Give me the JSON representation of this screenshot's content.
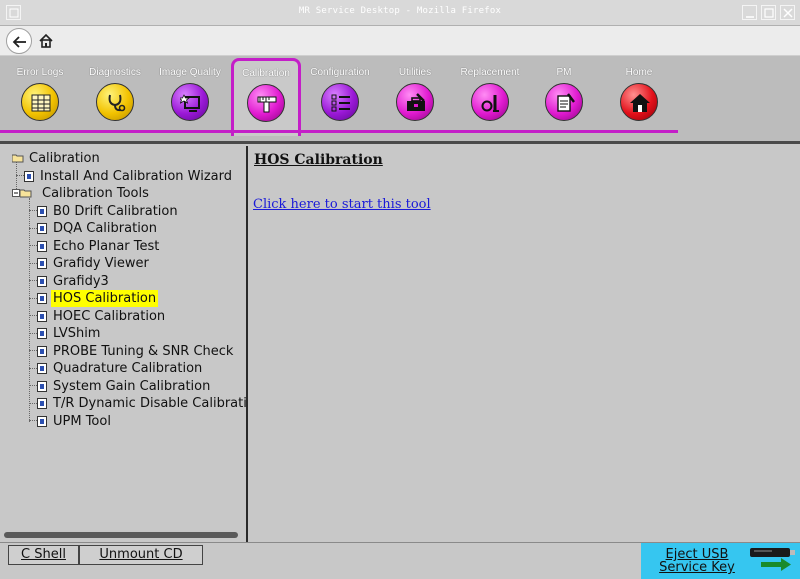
{
  "window": {
    "title": "MR Service Desktop - Mozilla Firefox"
  },
  "toolbar": {
    "tabs": [
      {
        "label": "Error Logs",
        "icon": "error-logs-icon",
        "color": "#f2c200"
      },
      {
        "label": "Diagnostics",
        "icon": "stethoscope-icon",
        "color": "#f2c200"
      },
      {
        "label": "Image Quality",
        "icon": "image-quality-icon",
        "color": "#9a18d6"
      },
      {
        "label": "Calibration",
        "icon": "caliper-icon",
        "color": "#e01ad0",
        "active": true
      },
      {
        "label": "Configuration",
        "icon": "checklist-icon",
        "color": "#9a18d6"
      },
      {
        "label": "Utilities",
        "icon": "toolbox-icon",
        "color": "#e01ad0"
      },
      {
        "label": "Replacement",
        "icon": "replacement-icon",
        "color": "#e01ad0"
      },
      {
        "label": "PM",
        "icon": "pm-icon",
        "color": "#e01ad0"
      },
      {
        "label": "Home",
        "icon": "home-icon",
        "color": "#e3101a"
      }
    ],
    "accent_color": "#c41ec8"
  },
  "tree": {
    "root": "Calibration",
    "items": [
      {
        "label": "Install And Calibration Wizard"
      },
      {
        "label": "Calibration Tools"
      },
      {
        "label": "B0 Drift Calibration"
      },
      {
        "label": "DQA Calibration"
      },
      {
        "label": "Echo Planar Test"
      },
      {
        "label": "Grafidy Viewer"
      },
      {
        "label": "Grafidy3"
      },
      {
        "label": "HOS Calibration",
        "selected": true
      },
      {
        "label": "HOEC Calibration"
      },
      {
        "label": "LVShim"
      },
      {
        "label": "PROBE Tuning & SNR Check"
      },
      {
        "label": "Quadrature Calibration"
      },
      {
        "label": "System Gain Calibration"
      },
      {
        "label": "T/R Dynamic Disable Calibration"
      },
      {
        "label": "UPM Tool"
      }
    ]
  },
  "content": {
    "heading": "HOS Calibration",
    "link": "Click here to start this tool"
  },
  "bottom": {
    "cshell": "C Shell",
    "unmount": "Unmount CD",
    "eject_line1": "Eject USB",
    "eject_line2": "Service Key",
    "eject_color": "#36c6f0"
  }
}
